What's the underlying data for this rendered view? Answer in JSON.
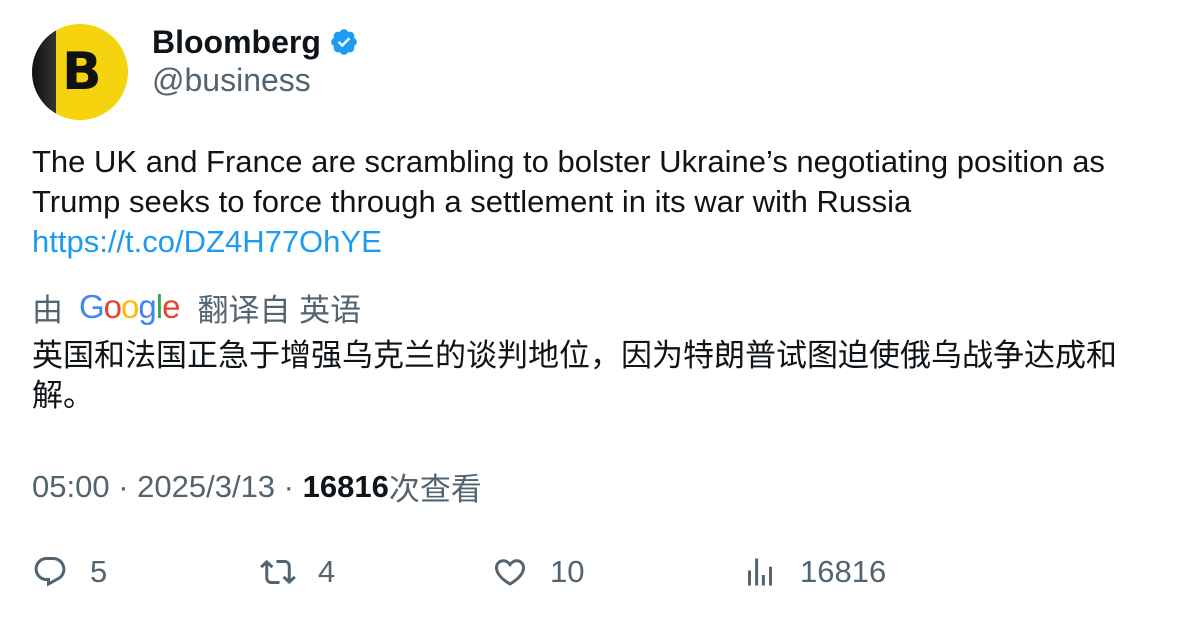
{
  "author": {
    "avatar_letter": "B",
    "name": "Bloomberg",
    "handle": "@business",
    "verified_color": "#1d9bf0"
  },
  "tweet": {
    "text_line1": "The UK and France are scrambling to bolster Ukraine’s negotiating position as",
    "text_line2": "Trump seeks to force through a settlement in its war with Russia",
    "link": "https://t.co/DZ4H77OhYE"
  },
  "translation": {
    "prefix": "由",
    "google_letters": [
      "G",
      "o",
      "o",
      "g",
      "l",
      "e"
    ],
    "google_colors": [
      "#4285f4",
      "#ea4335",
      "#fbbc05",
      "#4285f4",
      "#34a853",
      "#ea4335"
    ],
    "suffix": "翻译自 英语",
    "text": "英国和法国正急于增强乌克兰的谈判地位，因为特朗普试图迫使俄乌战争达成和解。"
  },
  "meta": {
    "time": "05:00",
    "sep1": " · ",
    "date": "2025/3/13",
    "sep2": " · ",
    "views": "16816",
    "views_suffix": "次查看"
  },
  "actions": {
    "reply": {
      "icon": "reply-icon",
      "count": "5"
    },
    "retweet": {
      "icon": "retweet-icon",
      "count": "4"
    },
    "like": {
      "icon": "heart-icon",
      "count": "10"
    },
    "views": {
      "icon": "analytics-icon",
      "count": "16816"
    }
  }
}
